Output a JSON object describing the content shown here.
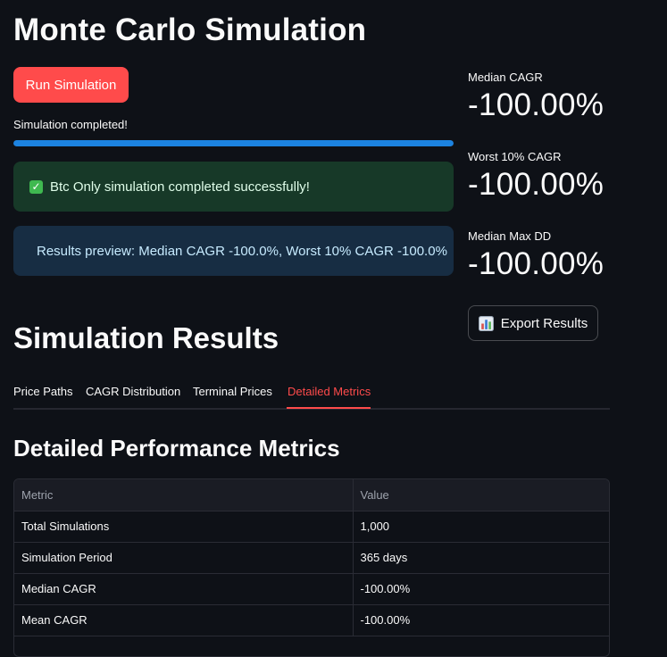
{
  "page": {
    "title": "Monte Carlo Simulation"
  },
  "controls": {
    "run_label": "Run Simulation",
    "progress_label": "Simulation completed!",
    "progress_fraction": 1.0
  },
  "alerts": {
    "success_text": "Btc Only simulation completed successfully!",
    "success_icon": "check-mark-icon",
    "info_text": "Results preview: Median CAGR -100.0%, Worst 10% CAGR -100.0%",
    "info_icon": "chart-increasing-icon"
  },
  "metrics": [
    {
      "label": "Median CAGR",
      "value": "-100.00%"
    },
    {
      "label": "Worst 10% CAGR",
      "value": "-100.00%"
    },
    {
      "label": "Median Max DD",
      "value": "-100.00%"
    }
  ],
  "export": {
    "label": "Export Results",
    "icon": "bar-chart-icon"
  },
  "results": {
    "title": "Simulation Results",
    "tabs": [
      {
        "label": "Price Paths",
        "active": false
      },
      {
        "label": "CAGR Distribution",
        "active": false
      },
      {
        "label": "Terminal Prices",
        "active": false
      },
      {
        "label": "Detailed Metrics",
        "active": true
      }
    ]
  },
  "metrics_table": {
    "title": "Detailed Performance Metrics",
    "headers": [
      "Metric",
      "Value"
    ],
    "rows": [
      [
        "Total Simulations",
        "1,000"
      ],
      [
        "Simulation Period",
        "365 days"
      ],
      [
        "Median CAGR",
        "-100.00%"
      ],
      [
        "Mean CAGR",
        "-100.00%"
      ]
    ]
  },
  "colors": {
    "background": "#0e1117",
    "primary": "#ff4b4b",
    "progress": "#1c83e1",
    "success_bg": "#173928",
    "info_bg": "#172d43"
  }
}
